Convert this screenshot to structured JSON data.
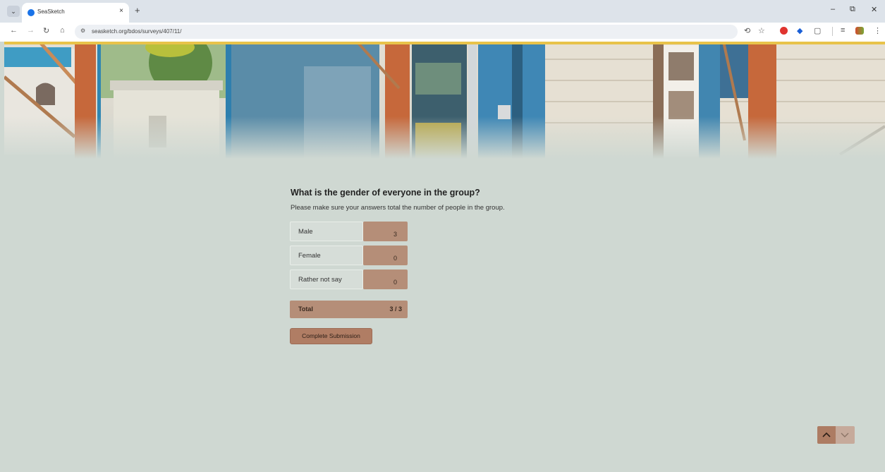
{
  "browser": {
    "tab_title": "SeaSketch",
    "tab_close": "×",
    "new_tab": "+",
    "url": "seasketch.org/bdos/surveys/407/11/",
    "icons": [
      "tab-menu-icon",
      "back-icon",
      "forward-icon",
      "reload-icon",
      "home-icon",
      "site-info-icon",
      "translate-icon",
      "bookmark-star-icon",
      "extension-icon",
      "reading-icon",
      "profile-icon",
      "menu-icon"
    ]
  },
  "survey": {
    "question": "What is the gender of everyone in the group?",
    "subtext": "Please make sure your answers total the number of people in the group.",
    "rows": [
      {
        "label": "Male",
        "value": "3"
      },
      {
        "label": "Female",
        "value": "0"
      },
      {
        "label": "Rather not say",
        "value": "0"
      }
    ],
    "total_label": "Total",
    "total_value": "3 / 3",
    "complete_button": "Complete Submission"
  },
  "colors": {
    "background": "#cfd8d2",
    "accent": "#b58e78",
    "button": "#b07d64"
  }
}
